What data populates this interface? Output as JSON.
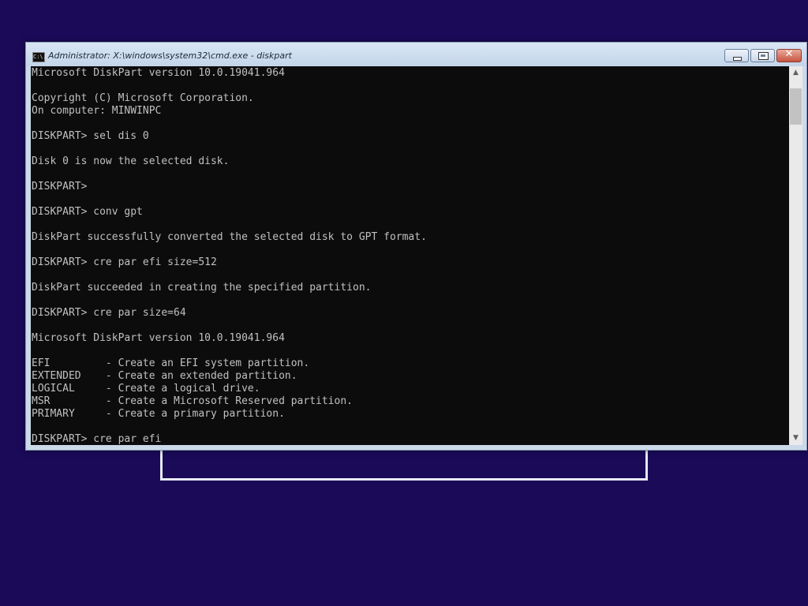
{
  "window": {
    "title": "Administrator: X:\\windows\\system32\\cmd.exe - diskpart",
    "icon_name": "cmd-icon",
    "icon_text": "C:\\.",
    "minimize_label": "minimize",
    "restore_label": "restore",
    "close_glyph": "✕"
  },
  "console": {
    "lines": [
      "Microsoft DiskPart version 10.0.19041.964",
      "",
      "Copyright (C) Microsoft Corporation.",
      "On computer: MINWINPC",
      "",
      "DISKPART> sel dis 0",
      "",
      "Disk 0 is now the selected disk.",
      "",
      "DISKPART>",
      "",
      "DISKPART> conv gpt",
      "",
      "DiskPart successfully converted the selected disk to GPT format.",
      "",
      "DISKPART> cre par efi size=512",
      "",
      "DiskPart succeeded in creating the specified partition.",
      "",
      "DISKPART> cre par size=64",
      "",
      "Microsoft DiskPart version 10.0.19041.964",
      "",
      "EFI         - Create an EFI system partition.",
      "EXTENDED    - Create an extended partition.",
      "LOGICAL     - Create a logical drive.",
      "MSR         - Create a Microsoft Reserved partition.",
      "PRIMARY     - Create a primary partition.",
      "",
      "DISKPART> cre par efi"
    ]
  },
  "scrollbar": {
    "up_arrow": "▲",
    "down_arrow": "▼"
  },
  "colors": {
    "desktop": "#1a0a58",
    "console_bg": "#0c0c0c",
    "console_fg": "#c0c0c0",
    "titlebar": "#cbd9ea",
    "close_button": "#c75440"
  }
}
